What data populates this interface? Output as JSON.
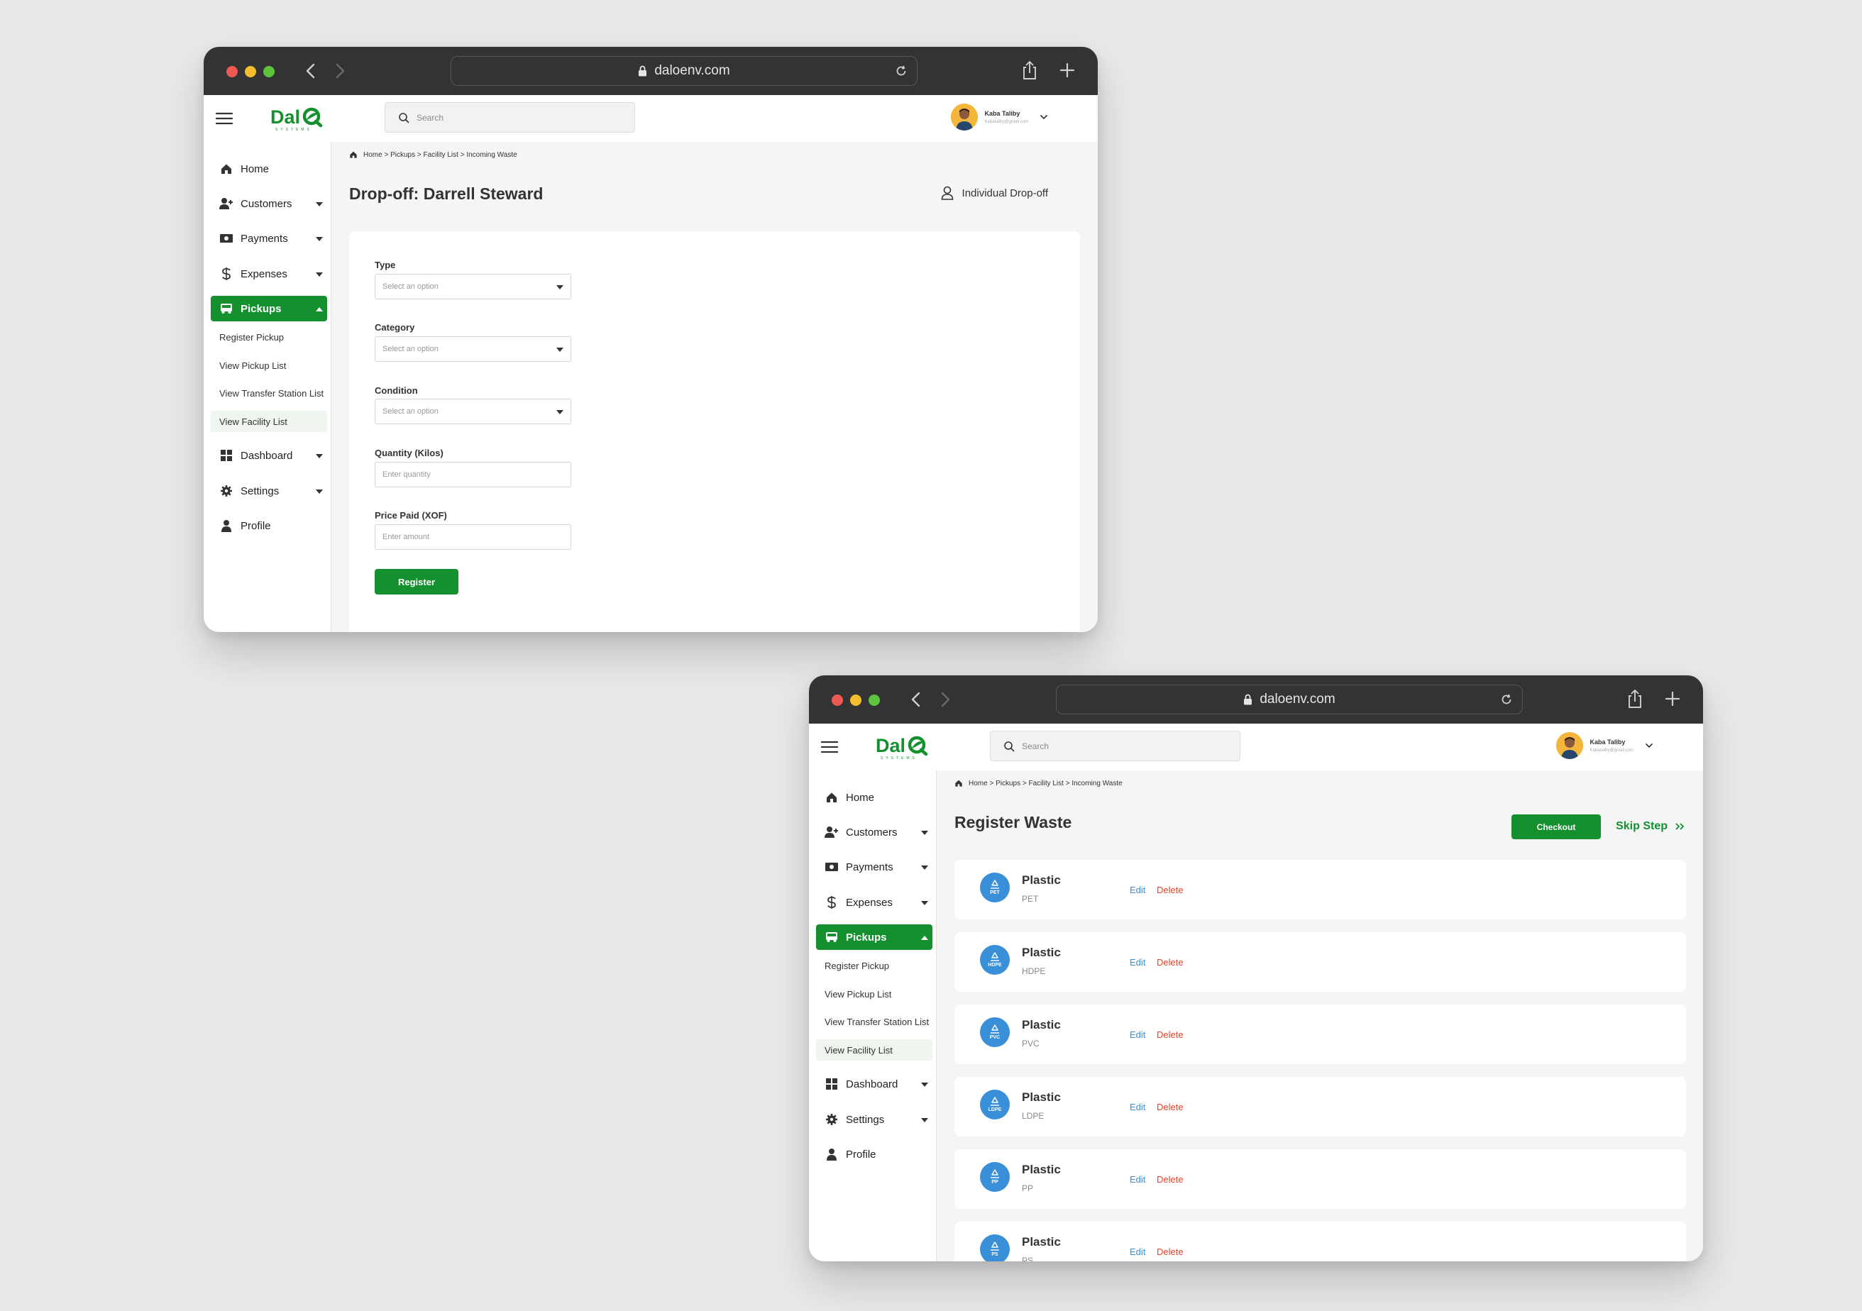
{
  "browser": {
    "url": "daloenv.com"
  },
  "header": {
    "search_placeholder": "Search",
    "user_name": "Kaba Taliby",
    "user_email": "Kabataliby@gmail.com"
  },
  "sidebar": {
    "items": [
      {
        "label": "Home"
      },
      {
        "label": "Customers"
      },
      {
        "label": "Payments"
      },
      {
        "label": "Expenses"
      },
      {
        "label": "Pickups"
      },
      {
        "label": "Dashboard"
      },
      {
        "label": "Settings"
      },
      {
        "label": "Profile"
      }
    ],
    "sub_items": [
      {
        "label": "Register Pickup"
      },
      {
        "label": "View Pickup List"
      },
      {
        "label": "View Transfer Station List"
      },
      {
        "label": "View Facility List"
      }
    ]
  },
  "breadcrumb": "Home > Pickups > Facility List > Incoming Waste",
  "dropoff": {
    "title": "Drop-off: Darrell Steward",
    "mode_label": "Individual Drop-off",
    "fields": [
      {
        "label": "Type",
        "placeholder": "Select an option"
      },
      {
        "label": "Category",
        "placeholder": "Select an option"
      },
      {
        "label": "Condition",
        "placeholder": "Select an option"
      },
      {
        "label": "Quantity (Kilos)",
        "placeholder": "Enter quantity"
      },
      {
        "label": "Price Paid (XOF)",
        "placeholder": "Enter amount"
      }
    ],
    "register_label": "Register"
  },
  "register_waste": {
    "title": "Register Waste",
    "checkout_label": "Checkout",
    "skip_label": "Skip Step",
    "edit_label": "Edit",
    "delete_label": "Delete",
    "items": [
      {
        "name": "Plastic",
        "code": "PET"
      },
      {
        "name": "Plastic",
        "code": "HDPE"
      },
      {
        "name": "Plastic",
        "code": "PVC"
      },
      {
        "name": "Plastic",
        "code": "LDPE"
      },
      {
        "name": "Plastic",
        "code": "PP"
      },
      {
        "name": "Plastic",
        "code": "PS"
      }
    ]
  },
  "colors": {
    "brand_green": "#14902f",
    "link_blue": "#3a8fd9",
    "danger_red": "#e2432a",
    "chrome_dark": "#333333"
  }
}
